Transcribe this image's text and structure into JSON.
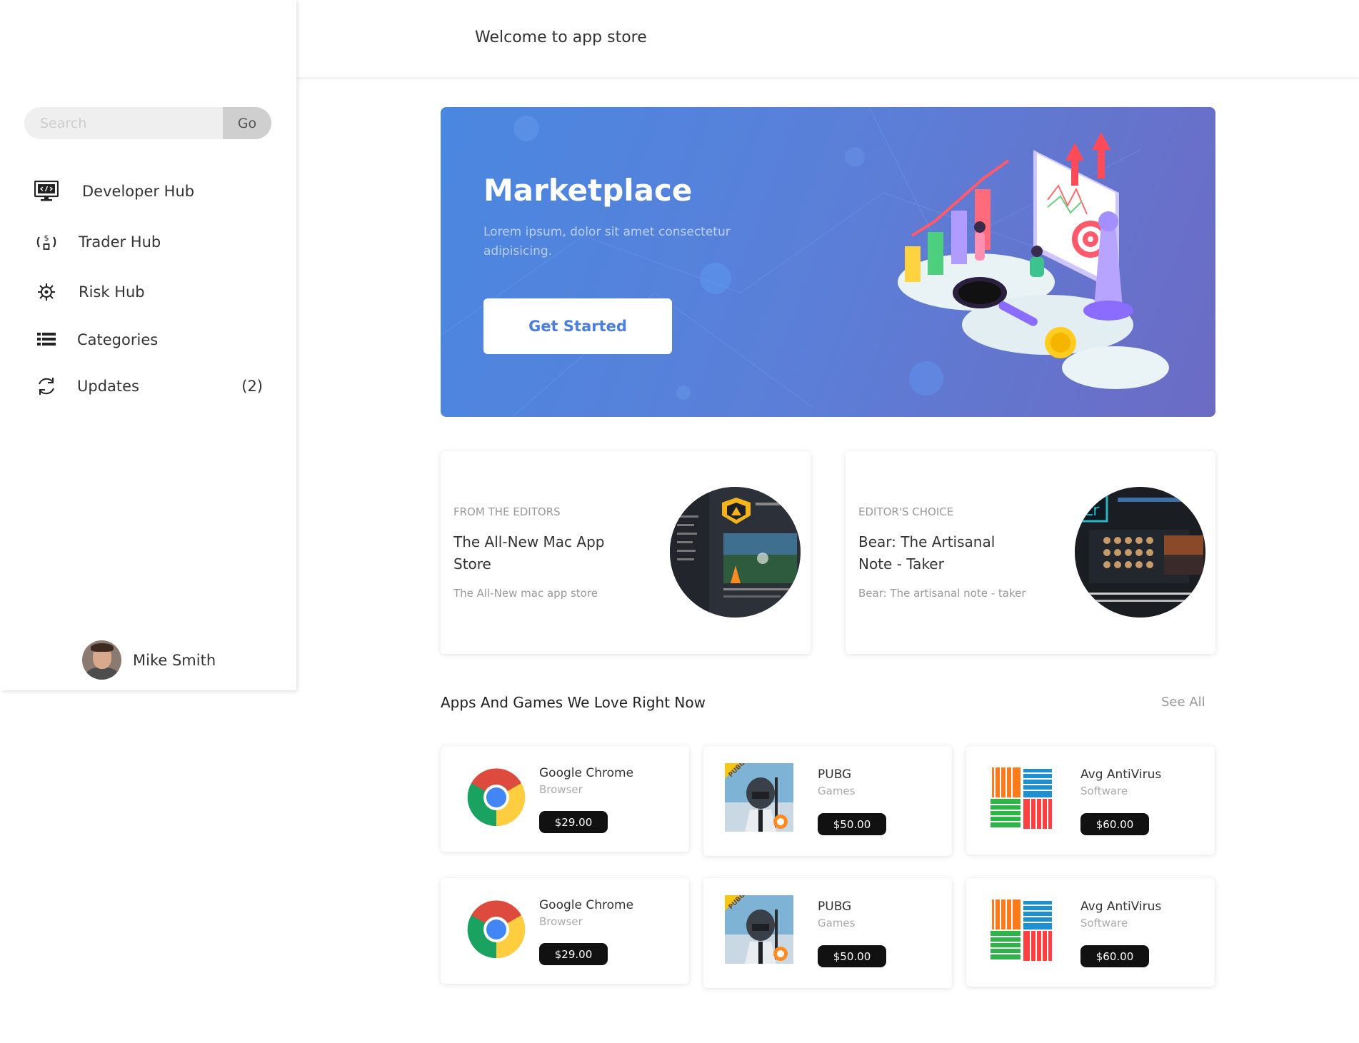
{
  "header": {
    "title": "Welcome to app store"
  },
  "sidebar": {
    "search": {
      "placeholder": "Search",
      "button": "Go"
    },
    "items": [
      {
        "label": "Developer Hub",
        "icon": "monitor-code-icon"
      },
      {
        "label": "Trader Hub",
        "icon": "currency-exchange-icon"
      },
      {
        "label": "Risk Hub",
        "icon": "virus-icon"
      },
      {
        "label": "Categories",
        "icon": "list-icon"
      },
      {
        "label": "Updates",
        "icon": "refresh-icon",
        "count": "(2)"
      }
    ],
    "user": {
      "name": "Mike Smith"
    }
  },
  "hero": {
    "title": "Marketplace",
    "description": "Lorem ipsum, dolor sit amet consectetur adipisicing.",
    "cta": "Get Started"
  },
  "editors": [
    {
      "kicker": "FROM THE EDITORS",
      "title": "The All-New Mac App Store",
      "subtitle": "The All-New mac app store"
    },
    {
      "kicker": "EDITOR'S CHOICE",
      "title": "Bear: The Artisanal Note - Taker",
      "subtitle": "Bear: The artisanal note - taker"
    }
  ],
  "section": {
    "title": "Apps And Games We Love Right Now",
    "see_all": "See All"
  },
  "apps": [
    {
      "name": "Google Chrome",
      "category": "Browser",
      "price": "$29.00",
      "icon": "chrome-icon"
    },
    {
      "name": "PUBG",
      "category": "Games",
      "price": "$50.00",
      "icon": "pubg-icon"
    },
    {
      "name": "Avg AntiVirus",
      "category": "Software",
      "price": "$60.00",
      "icon": "avg-icon"
    },
    {
      "name": "Google Chrome",
      "category": "Browser",
      "price": "$29.00",
      "icon": "chrome-icon"
    },
    {
      "name": "PUBG",
      "category": "Games",
      "price": "$50.00",
      "icon": "pubg-icon"
    },
    {
      "name": "Avg AntiVirus",
      "category": "Software",
      "price": "$60.00",
      "icon": "avg-icon"
    }
  ]
}
